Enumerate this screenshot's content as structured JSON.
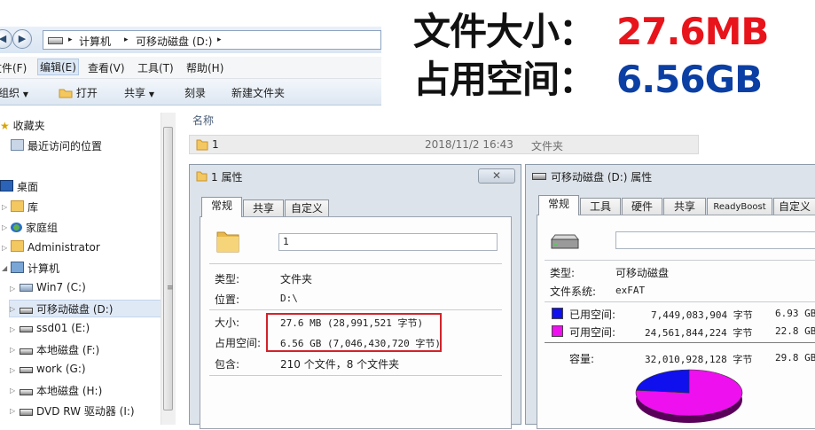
{
  "headline": {
    "file_size_label": "文件大小：",
    "file_size_value": "27.6MB",
    "disk_usage_label": "占用空间：",
    "disk_usage_value": "6.56GB",
    "colors": {
      "label": "#111111",
      "file_size": "#e8141b",
      "disk_usage": "#0b3fa3"
    }
  },
  "explorer": {
    "breadcrumbs": [
      "计算机",
      "可移动磁盘 (D:)"
    ],
    "menu": [
      "文件(F)",
      "编辑(E)",
      "查看(V)",
      "工具(T)",
      "帮助(H)"
    ],
    "toolbar": {
      "organize": "组织",
      "open": "打开",
      "share": "共享",
      "burn": "刻录",
      "new_folder": "新建文件夹"
    },
    "nav": {
      "favorites": "收藏夹",
      "recent_places": "最近访问的位置",
      "desktop": "桌面",
      "libraries": "库",
      "homegroup": "家庭组",
      "administrator": "Administrator",
      "computer": "计算机",
      "drives": [
        "Win7 (C:)",
        "可移动磁盘 (D:)",
        "ssd01 (E:)",
        "本地磁盘 (F:)",
        "work (G:)",
        "本地磁盘 (H:)",
        "DVD RW 驱动器 (I:)"
      ]
    },
    "column_name": "名称",
    "file_row": {
      "name": "1",
      "modified": "2018/11/2 16:43",
      "type": "文件夹"
    }
  },
  "folder_props": {
    "title": "1 属性",
    "tabs": [
      "常规",
      "共享",
      "自定义"
    ],
    "name_value": "1",
    "rows": [
      {
        "label": "类型:",
        "value": "文件夹"
      },
      {
        "label": "位置:",
        "value": "D:\\"
      },
      {
        "label": "大小:",
        "value": "27.6 MB (28,991,521 字节)"
      },
      {
        "label": "占用空间:",
        "value": "6.56 GB (7,046,430,720 字节)"
      },
      {
        "label": "包含:",
        "value": "210 个文件，8 个文件夹"
      }
    ],
    "highlight_color": "#d2232a"
  },
  "drive_props": {
    "title": "可移动磁盘 (D:) 属性",
    "tabs": [
      "常规",
      "工具",
      "硬件",
      "共享",
      "ReadyBoost",
      "自定义"
    ],
    "type_label": "类型:",
    "type_value": "可移动磁盘",
    "fs_label": "文件系统:",
    "fs_value": "exFAT",
    "used": {
      "label": "已用空间:",
      "bytes": "7,449,083,904 字节",
      "size": "6.93 GB",
      "color": "#1010ee"
    },
    "free": {
      "label": "可用空间:",
      "bytes": "24,561,844,224 字节",
      "size": "22.8 GB",
      "color": "#ee10ee"
    },
    "capacity": {
      "label": "容量:",
      "bytes": "32,010,928,128 字节",
      "size": "29.8 GB"
    },
    "used_fraction": 0.233
  }
}
